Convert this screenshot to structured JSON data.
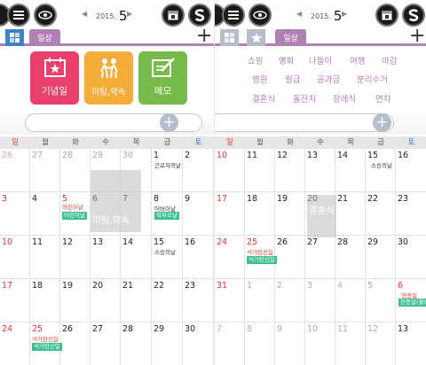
{
  "header": {
    "year": "2015.",
    "month": "5",
    "prev_arrow": "◀",
    "next_arrow": "▶"
  },
  "tabs": {
    "daily_label": "일상",
    "add": "+"
  },
  "quick_buttons": [
    {
      "label": "기념일",
      "color": "#e8416b"
    },
    {
      "label": "미팅,약속",
      "color": "#f4ad3b"
    },
    {
      "label": "메모",
      "color": "#77b94a"
    }
  ],
  "categories": [
    [
      "쇼핑",
      "영화",
      "나들이",
      "여행",
      "마감"
    ],
    [
      "병원",
      "월급",
      "공과금",
      "분리수거"
    ],
    [
      "결혼식",
      "돌잔치",
      "장례식",
      "연차"
    ]
  ],
  "search": {
    "button": "+"
  },
  "weekdays": [
    "일",
    "월",
    "화",
    "수",
    "목",
    "금",
    "토"
  ],
  "left_calendar": {
    "weeks": [
      [
        "26",
        "27",
        "28",
        "29",
        "30",
        "1",
        "2"
      ],
      [
        "3",
        "4",
        "5",
        "6",
        "7",
        "8",
        "9"
      ],
      [
        "10",
        "11",
        "12",
        "13",
        "14",
        "15",
        "16"
      ],
      [
        "17",
        "18",
        "19",
        "20",
        "21",
        "22",
        "23"
      ],
      [
        "24",
        "25",
        "26",
        "27",
        "28",
        "29",
        "30"
      ]
    ],
    "events": {
      "workers_day": "근로자의날",
      "children_day": "어린이날",
      "children_day_tag": "어린이날",
      "parents_day": "어버이날",
      "school_tag": "학부모날",
      "teachers_day": "스승의날",
      "buddha_day": "석가탄신일",
      "buddha_tag": "석가탄신일",
      "meeting_overlay": "미팅,약속"
    }
  },
  "right_calendar": {
    "weeks": [
      [
        "10",
        "11",
        "12",
        "13",
        "14",
        "15",
        "16"
      ],
      [
        "17",
        "18",
        "19",
        "20",
        "21",
        "22",
        "23"
      ],
      [
        "24",
        "25",
        "26",
        "27",
        "28",
        "29",
        "30"
      ],
      [
        "31",
        "1",
        "2",
        "3",
        "4",
        "5",
        "6"
      ],
      [
        "7",
        "8",
        "9",
        "10",
        "11",
        "12",
        "13"
      ]
    ],
    "events": {
      "teachers_day": "스승의날",
      "buddha_day": "석가탄신일",
      "buddha_tag": "석가탄신일",
      "memorial_day": "현충일",
      "memorial_tag": "현충일(월)",
      "wedding_overlay": "결혼식"
    }
  }
}
